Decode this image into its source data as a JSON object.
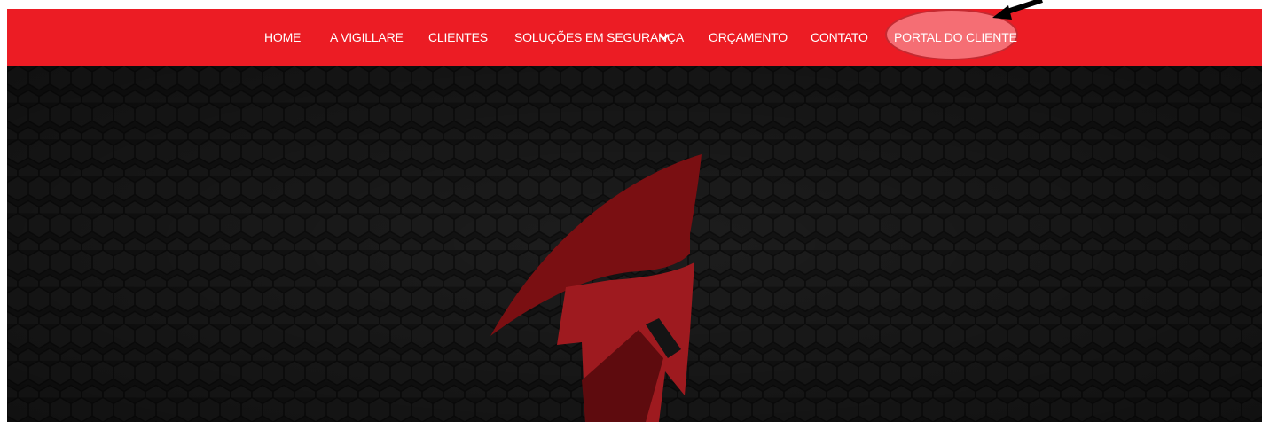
{
  "colors": {
    "nav_background": "#ec1c24",
    "hero_background": "#141414",
    "highlight": "#f77d82",
    "logo_dark": "#7a0f12",
    "logo_light": "#9e1a1f",
    "arrow": "#000000"
  },
  "navbar": {
    "items": [
      {
        "label": "HOME"
      },
      {
        "label": "A VIGILLARE"
      },
      {
        "label": "CLIENTES"
      },
      {
        "label": "SOLUÇÕES EM SEGURANÇA",
        "icon": "chevron-down-icon"
      },
      {
        "label": "ORÇAMENTO"
      },
      {
        "label": "CONTATO"
      },
      {
        "label": "PORTAL DO CLIENTE",
        "highlighted": true
      }
    ]
  },
  "annotation": {
    "icon": "pointer-arrow-icon"
  },
  "hero": {
    "logo_icon": "spartan-helmet-logo-icon",
    "pattern": "hexagon-pattern"
  }
}
